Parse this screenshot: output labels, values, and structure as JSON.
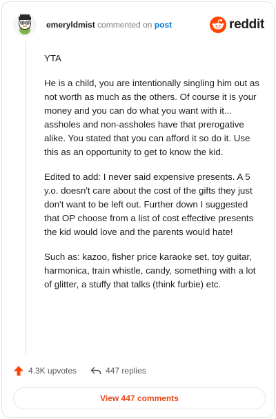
{
  "header": {
    "username": "emeryldmist",
    "action_text": "commented on",
    "post_link": "post",
    "brand_word": "reddit"
  },
  "comment": {
    "paragraphs": [
      "YTA",
      "He is a child, you are intentionally singling him out as not worth as much as the others. Of course it is your money and you can do what you want with it... assholes and non-assholes have that prerogative alike. You stated that you can afford it so do it. Use this as an opportunity to get to know the kid.",
      "Edited to add: I never said expensive presents. A 5 y.o. doesn't care about the cost of the gifts they just don't want to be left out. Further down I suggested that OP choose from a list of cost effective presents the kid would love and the parents would hate!",
      "Such as: kazoo, fisher price karaoke set, toy guitar, harmonica, train whistle, candy, something with a lot of glitter, a stuffy that talks (think furbie) etc."
    ]
  },
  "footer": {
    "upvotes": "4.3K upvotes",
    "replies": "447 replies"
  },
  "view_button": "View 447 comments",
  "colors": {
    "upvote": "#ff4500",
    "link": "#0079d3",
    "view_button_text": "#e44a19",
    "brand": "#ff4500"
  }
}
